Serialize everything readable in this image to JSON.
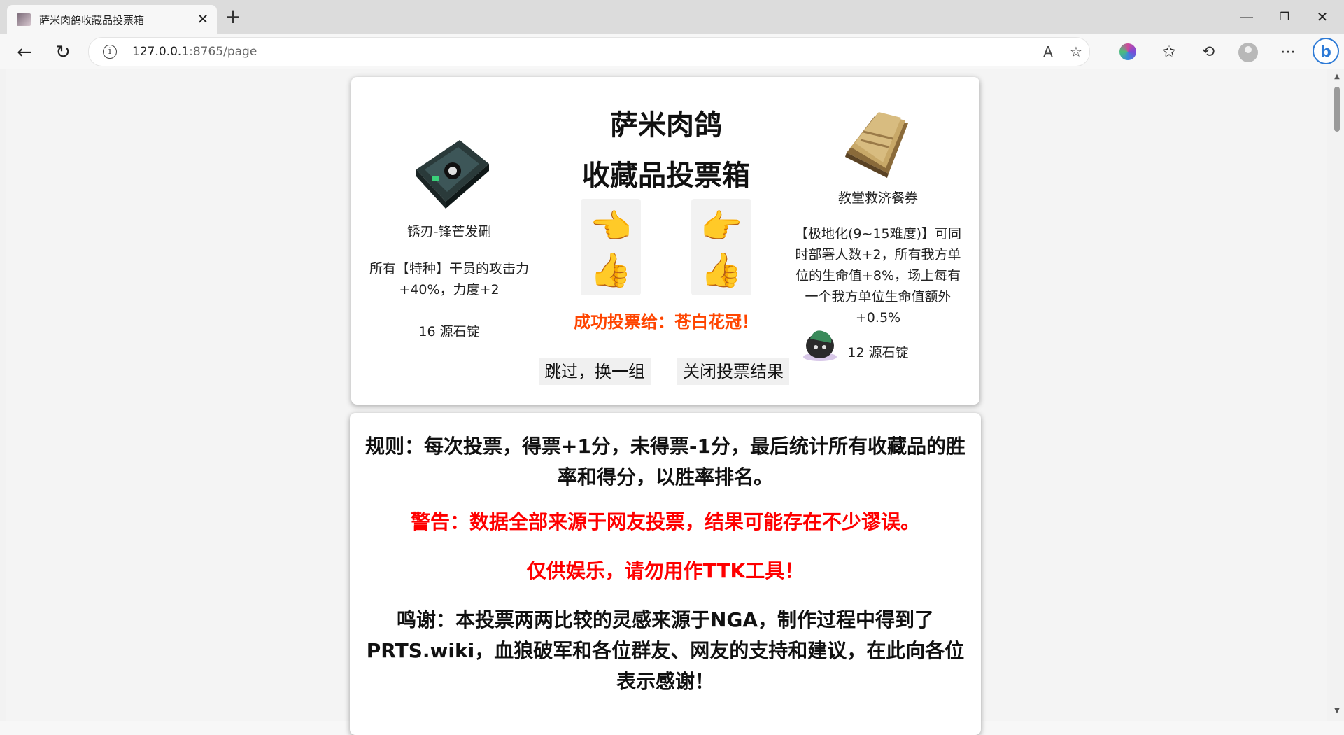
{
  "browser": {
    "tab_title": "萨米肉鸽收藏品投票箱",
    "url_host": "127.0.0.1",
    "url_rest": ":8765/page"
  },
  "vote": {
    "title_line1": "萨米肉鸽",
    "title_line2": "收藏品投票箱",
    "left_item": {
      "name": "锈刃-锋芒发硎",
      "desc": "所有【特种】干员的攻击力+40%，力度+2",
      "cost": "16 源石锭"
    },
    "right_item": {
      "name": "教堂救济餐券",
      "desc": "【极地化(9~15难度)】可同时部署人数+2，所有我方单位的生命值+8%，场上每有一个我方单位生命值额外+0.5%",
      "cost": "12 源石锭"
    },
    "left_vote_hand": "👈",
    "right_vote_hand": "👉",
    "thumbs": "👍",
    "result_text": "成功投票给：苍白花冠！",
    "skip_label": "跳过，换一组",
    "close_label": "关闭投票结果"
  },
  "info": {
    "rules": "规则：每次投票，得票+1分，未得票-1分，最后统计所有收藏品的胜率和得分，以胜率排名。",
    "warning": "警告：数据全部来源于网友投票，结果可能存在不少谬误。",
    "entertainment": "仅供娱乐，请勿用作TTK工具！",
    "thanks": "鸣谢：本投票两两比较的灵感来源于NGA，制作过程中得到了PRTS.wiki，血狼破军和各位群友、网友的支持和建议，在此向各位表示感谢！"
  },
  "colors": {
    "result": "#ff4500",
    "warning": "#ff0000"
  }
}
